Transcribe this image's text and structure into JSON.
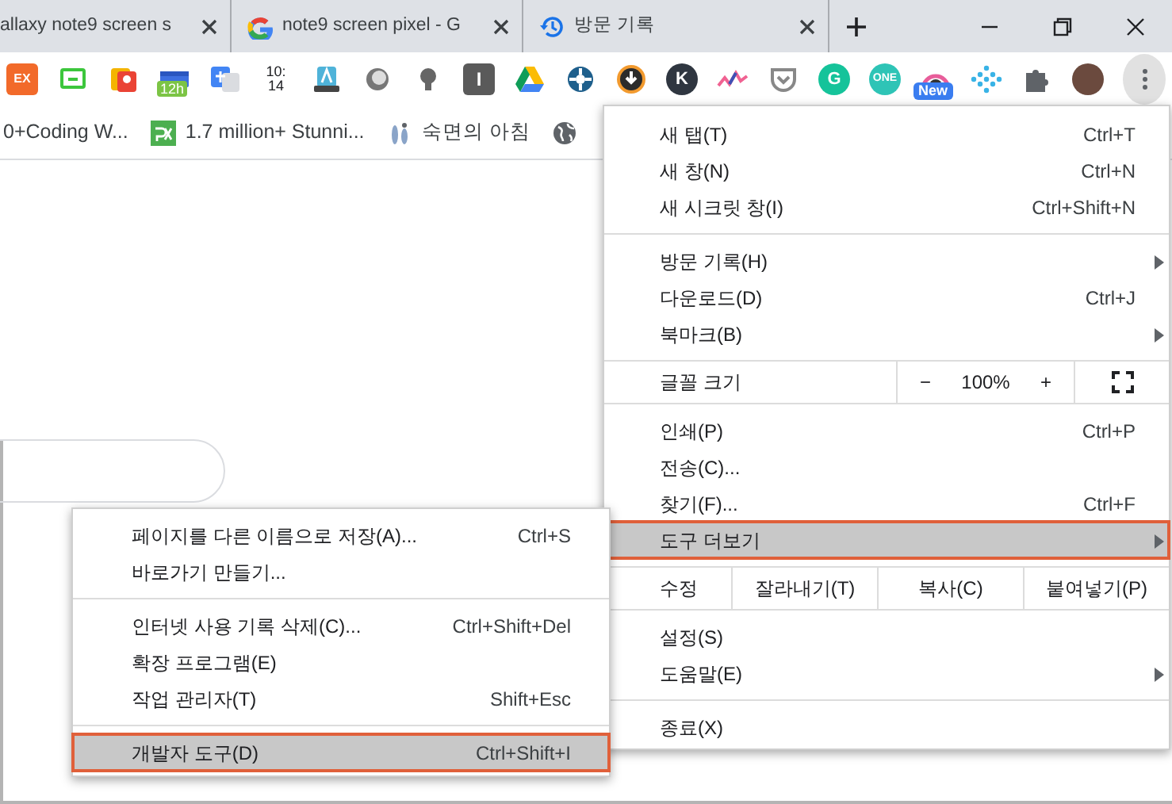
{
  "tabs": [
    {
      "title": "allaxy note9 screen s",
      "kind": "plain"
    },
    {
      "title": "note9 screen pixel - G",
      "kind": "search"
    },
    {
      "title": "방문 기록",
      "kind": "history"
    }
  ],
  "extensions": [
    {
      "kind": "square-letter",
      "text": "EX",
      "color": "#f26a2a"
    },
    {
      "kind": "monitor"
    },
    {
      "kind": "map"
    },
    {
      "kind": "calendar",
      "text": "12h"
    },
    {
      "kind": "translate"
    },
    {
      "kind": "clock",
      "lines": [
        "10:",
        "14"
      ]
    },
    {
      "kind": "keyboard"
    },
    {
      "kind": "orb"
    },
    {
      "kind": "bulb"
    },
    {
      "kind": "square-letter",
      "text": "I",
      "color": "#5a5a5a"
    },
    {
      "kind": "drive"
    },
    {
      "kind": "ring"
    },
    {
      "kind": "download"
    },
    {
      "kind": "circle-letter",
      "text": "K",
      "color": "#2f3640"
    },
    {
      "kind": "squiggle"
    },
    {
      "kind": "pocket"
    },
    {
      "kind": "circle-letter",
      "text": "G",
      "color": "#15c39a"
    },
    {
      "kind": "circle-letter",
      "text": "ONE",
      "color": "#2ec4b6"
    },
    {
      "kind": "camera",
      "badge": "New"
    },
    {
      "kind": "dots"
    },
    {
      "kind": "puzzle"
    },
    {
      "kind": "avatar"
    }
  ],
  "bookmarks": [
    {
      "title": "0+Coding W...",
      "kind": "plain"
    },
    {
      "title": "1.7 million+  Stunni...",
      "kind": "px"
    },
    {
      "title": "숙면의 아침",
      "kind": "figure"
    },
    {
      "kind": "globe"
    }
  ],
  "main_menu": {
    "items": [
      {
        "kind": "item",
        "label": "새 탭(T)",
        "shortcut": "Ctrl+T",
        "has_submenu": false,
        "selected": false
      },
      {
        "kind": "item",
        "label": "새 창(N)",
        "shortcut": "Ctrl+N",
        "has_submenu": false,
        "selected": false
      },
      {
        "kind": "item",
        "label": "새 시크릿 창(I)",
        "shortcut": "Ctrl+Shift+N",
        "has_submenu": false,
        "selected": false
      },
      {
        "kind": "separator"
      },
      {
        "kind": "item",
        "label": "방문 기록(H)",
        "has_submenu": true,
        "selected": false
      },
      {
        "kind": "item",
        "label": "다운로드(D)",
        "shortcut": "Ctrl+J",
        "has_submenu": false,
        "selected": false
      },
      {
        "kind": "item",
        "label": "북마크(B)",
        "has_submenu": true,
        "selected": false
      },
      {
        "kind": "separator"
      },
      {
        "kind": "zoom",
        "label": "글꼴 크기",
        "minus": "−",
        "value": "100%",
        "plus": "+"
      },
      {
        "kind": "separator"
      },
      {
        "kind": "item",
        "label": "인쇄(P)",
        "shortcut": "Ctrl+P",
        "has_submenu": false,
        "selected": false
      },
      {
        "kind": "item",
        "label": "전송(C)...",
        "has_submenu": false,
        "selected": false
      },
      {
        "kind": "item",
        "label": "찾기(F)...",
        "shortcut": "Ctrl+F",
        "has_submenu": false,
        "selected": false
      },
      {
        "kind": "item",
        "label": "도구 더보기",
        "has_submenu": true,
        "selected": true
      },
      {
        "kind": "separator"
      },
      {
        "kind": "edit",
        "label": "수정",
        "buttons": [
          "잘라내기(T)",
          "복사(C)",
          "붙여넣기(P)"
        ]
      },
      {
        "kind": "separator"
      },
      {
        "kind": "item",
        "label": "설정(S)",
        "has_submenu": false,
        "selected": false
      },
      {
        "kind": "item",
        "label": "도움말(E)",
        "has_submenu": true,
        "selected": false
      },
      {
        "kind": "separator"
      },
      {
        "kind": "item",
        "label": "종료(X)",
        "has_submenu": false,
        "selected": false
      }
    ]
  },
  "submenu": {
    "items": [
      {
        "kind": "item",
        "label": "페이지를 다른 이름으로 저장(A)...",
        "shortcut": "Ctrl+S",
        "selected": false
      },
      {
        "kind": "item",
        "label": "바로가기 만들기...",
        "selected": false
      },
      {
        "kind": "separator"
      },
      {
        "kind": "item",
        "label": "인터넷 사용 기록 삭제(C)...",
        "shortcut": "Ctrl+Shift+Del",
        "selected": false
      },
      {
        "kind": "item",
        "label": "확장 프로그램(E)",
        "selected": false
      },
      {
        "kind": "item",
        "label": "작업 관리자(T)",
        "shortcut": "Shift+Esc",
        "selected": false
      },
      {
        "kind": "separator"
      },
      {
        "kind": "item",
        "label": "개발자 도구(D)",
        "shortcut": "Ctrl+Shift+I",
        "selected": true
      }
    ]
  }
}
